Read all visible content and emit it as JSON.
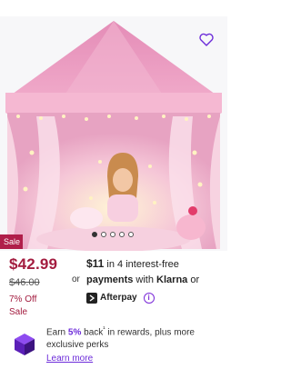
{
  "product": {
    "sale_badge": "Sale",
    "price": "$42.99",
    "was_price": "$46.00",
    "discount": "7% Off",
    "discount_suffix": "Sale",
    "carousel": {
      "count": 5,
      "active": 1
    },
    "wishlist_icon": "heart-icon"
  },
  "payments": {
    "amount": "$11",
    "installments": "in 4 interest-free",
    "payments_word": "payments",
    "with": "with",
    "klarna": "Klarna",
    "or1": "or",
    "or2": "or",
    "afterpay": "Afterpay",
    "info_icon": "i"
  },
  "rewards": {
    "earn": "Earn",
    "percent": "5%",
    "back": "back",
    "sup": "¹",
    "rest": "in rewards, plus more exclusive perks",
    "learn_more": "Learn more"
  },
  "colors": {
    "accent": "#a31c3f",
    "sale_badge": "#b01e4a",
    "link": "#6c2bd9",
    "tent_pink": "#e898be"
  }
}
